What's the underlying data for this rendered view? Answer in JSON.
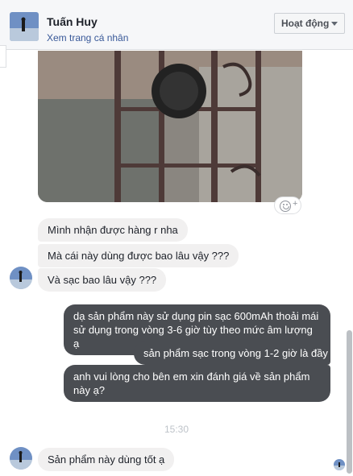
{
  "header": {
    "name": "Tuấn Huy",
    "profile_link": "Xem trang cá nhân",
    "status": "Hoạt động",
    "avatar_icon": "user-avatar"
  },
  "icons": {
    "react": "smiley-add-icon",
    "react_plus": "+"
  },
  "messages": {
    "incoming": [
      "Mình nhận được hàng r nha",
      "Mà cái này dùng được bao lâu vậy ???",
      "Và sạc bao lâu vậy ???"
    ],
    "outgoing": [
      "dạ sản phẩm này sử dụng pin sạc 600mAh thoải mái sử dụng trong vòng 3-6 giờ tùy theo mức âm lượng ạ",
      "sản phẩm sạc trong vòng 1-2 giờ là đầy ạ",
      "anh vui lòng cho bên em xin đánh giá về sản phẩm này ạ?"
    ],
    "timestamp": "15:30",
    "last_incoming": "Sản phẩm này dùng tốt ạ"
  },
  "colors": {
    "outgoing_bubble": "#4a4d52",
    "incoming_bubble": "#f1f0f0",
    "link": "#385898"
  }
}
